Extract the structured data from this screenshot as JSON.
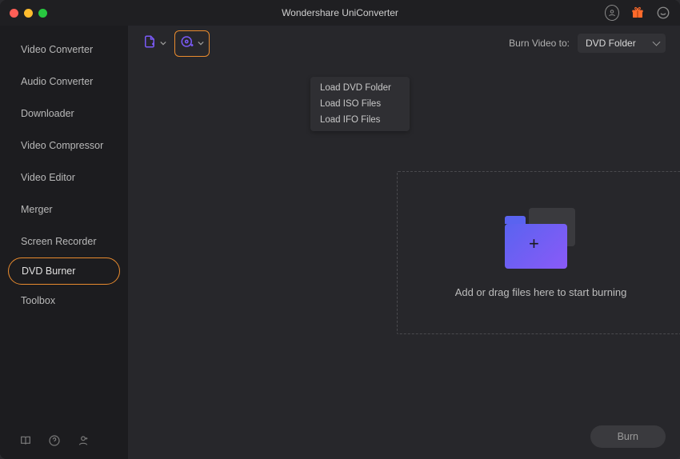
{
  "title": "Wondershare UniConverter",
  "sidebar": {
    "items": [
      {
        "label": "Video Converter"
      },
      {
        "label": "Audio Converter"
      },
      {
        "label": "Downloader"
      },
      {
        "label": "Video Compressor"
      },
      {
        "label": "Video Editor"
      },
      {
        "label": "Merger"
      },
      {
        "label": "Screen Recorder"
      },
      {
        "label": "DVD Burner"
      },
      {
        "label": "Toolbox"
      }
    ],
    "active_index": 7
  },
  "toolbar": {
    "burn_video_label": "Burn Video to:",
    "burn_video_target": "DVD Folder"
  },
  "load_menu": {
    "items": [
      {
        "label": "Load DVD Folder"
      },
      {
        "label": "Load ISO Files"
      },
      {
        "label": "Load IFO Files"
      }
    ]
  },
  "dropzone": {
    "prompt": "Add or drag files here to start burning"
  },
  "footer": {
    "burn_label": "Burn"
  }
}
